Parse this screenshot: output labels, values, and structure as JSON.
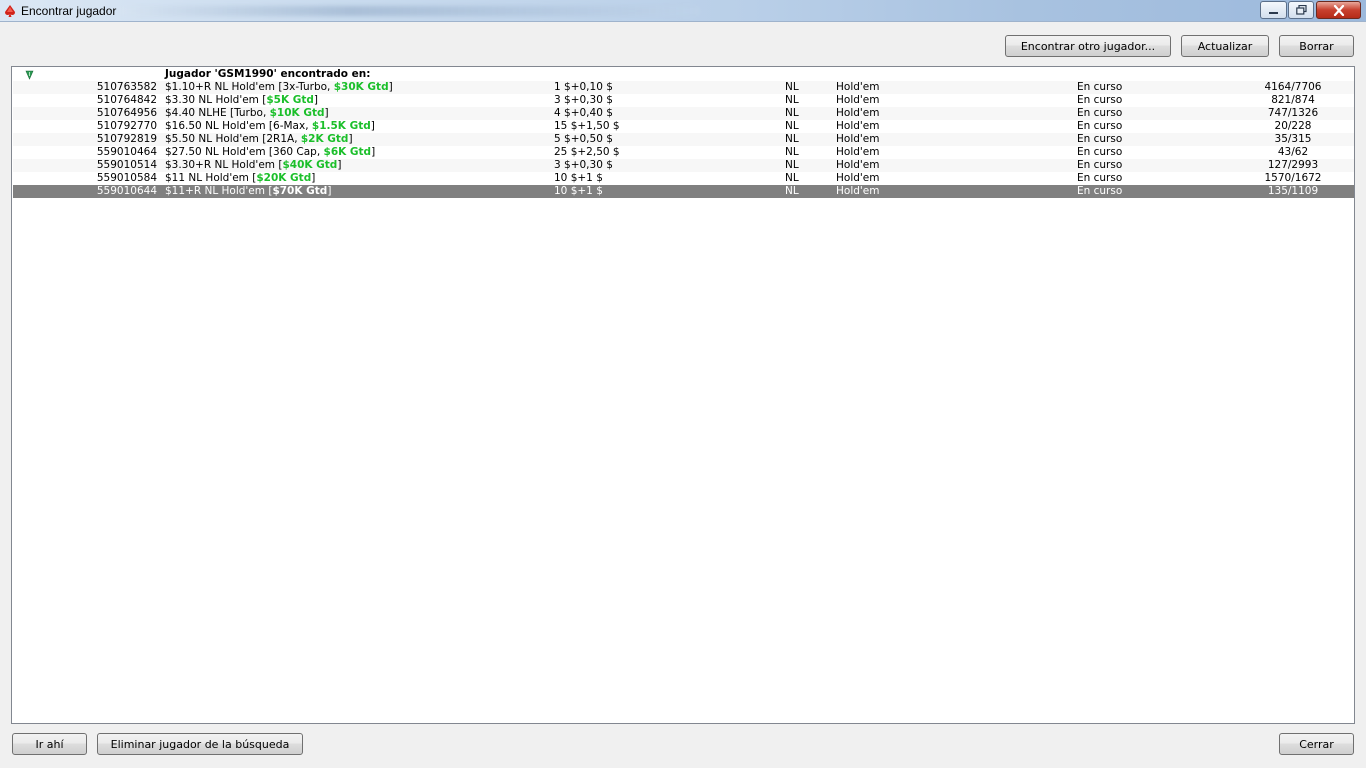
{
  "window": {
    "title": "Encontrar jugador",
    "controls": [
      "minimize-icon",
      "maximize-icon",
      "close-icon"
    ]
  },
  "toolbar": {
    "find_other": "Encontrar otro jugador...",
    "refresh": "Actualizar",
    "clear": "Borrar"
  },
  "list": {
    "header": "Jugador 'GSM1990' encontrado en:",
    "rows": [
      {
        "id": "510763582",
        "name_pre": "$1.10+R NL Hold'em [3x-Turbo, ",
        "gtd": "$30K Gtd",
        "name_post": "]",
        "buyin": "1 $+0,10 $",
        "limit": "NL",
        "game": "Hold'em",
        "status": "En curso",
        "players": "4164/7706"
      },
      {
        "id": "510764842",
        "name_pre": "$3.30 NL Hold'em [",
        "gtd": "$5K Gtd",
        "name_post": "]",
        "buyin": "3 $+0,30 $",
        "limit": "NL",
        "game": "Hold'em",
        "status": "En curso",
        "players": "821/874"
      },
      {
        "id": "510764956",
        "name_pre": "$4.40 NLHE [Turbo, ",
        "gtd": "$10K Gtd",
        "name_post": "]",
        "buyin": "4 $+0,40 $",
        "limit": "NL",
        "game": "Hold'em",
        "status": "En curso",
        "players": "747/1326"
      },
      {
        "id": "510792770",
        "name_pre": "$16.50 NL Hold'em [6-Max, ",
        "gtd": "$1.5K Gtd",
        "name_post": "]",
        "buyin": "15 $+1,50 $",
        "limit": "NL",
        "game": "Hold'em",
        "status": "En curso",
        "players": "20/228"
      },
      {
        "id": "510792819",
        "name_pre": "$5.50 NL Hold'em [2R1A, ",
        "gtd": "$2K Gtd",
        "name_post": "]",
        "buyin": "5 $+0,50 $",
        "limit": "NL",
        "game": "Hold'em",
        "status": "En curso",
        "players": "35/315"
      },
      {
        "id": "559010464",
        "name_pre": "$27.50 NL Hold'em [360 Cap, ",
        "gtd": "$6K Gtd",
        "name_post": "]",
        "buyin": "25 $+2,50 $",
        "limit": "NL",
        "game": "Hold'em",
        "status": "En curso",
        "players": "43/62"
      },
      {
        "id": "559010514",
        "name_pre": "$3.30+R NL Hold'em [",
        "gtd": "$40K Gtd",
        "name_post": "]",
        "buyin": "3 $+0,30 $",
        "limit": "NL",
        "game": "Hold'em",
        "status": "En curso",
        "players": "127/2993"
      },
      {
        "id": "559010584",
        "name_pre": "$11 NL Hold'em [",
        "gtd": "$20K Gtd",
        "name_post": "]",
        "buyin": "10 $+1 $",
        "limit": "NL",
        "game": "Hold'em",
        "status": "En curso",
        "players": "1570/1672"
      },
      {
        "id": "559010644",
        "name_pre": "$11+R NL Hold'em [",
        "gtd": "$70K Gtd",
        "name_post": "]",
        "buyin": "10 $+1 $",
        "limit": "NL",
        "game": "Hold'em",
        "status": "En curso",
        "players": "135/1109",
        "selected": true
      }
    ]
  },
  "footer": {
    "go_there": "Ir ahí",
    "remove_player": "Eliminar jugador de la búsqueda",
    "close": "Cerrar"
  },
  "colors": {
    "guarantee": "#1bbf2a",
    "selected_row": "#808080",
    "window_bg": "#f0f0f0"
  }
}
